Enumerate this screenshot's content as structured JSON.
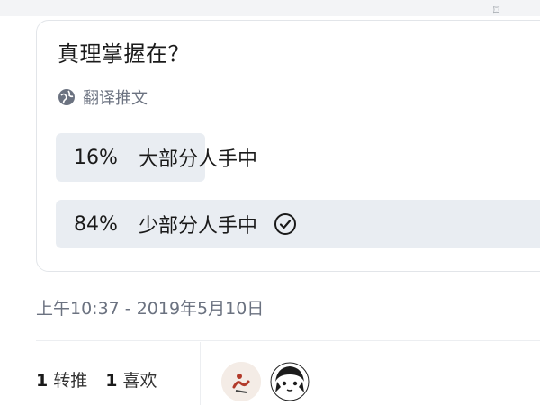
{
  "poll": {
    "question": "真理掌握在？",
    "translate_label": "翻译推文",
    "options": [
      {
        "percent": "16%",
        "percent_value": 16,
        "label": "大部分人手中",
        "selected": false
      },
      {
        "percent": "84%",
        "percent_value": 84,
        "label": "少部分人手中",
        "selected": true
      }
    ]
  },
  "timestamp": "上午10:37 - 2019年5月10日",
  "stats": {
    "retweets_count": "1",
    "retweets_label": "转推",
    "likes_count": "1",
    "likes_label": "喜欢"
  },
  "icons": {
    "translate": "globe-icon",
    "selected": "check-circle-icon",
    "top_right": "close-icon"
  },
  "colors": {
    "bar_fill": "#e9edf2",
    "muted_text": "#6b7280",
    "border": "#e2e5e9"
  }
}
